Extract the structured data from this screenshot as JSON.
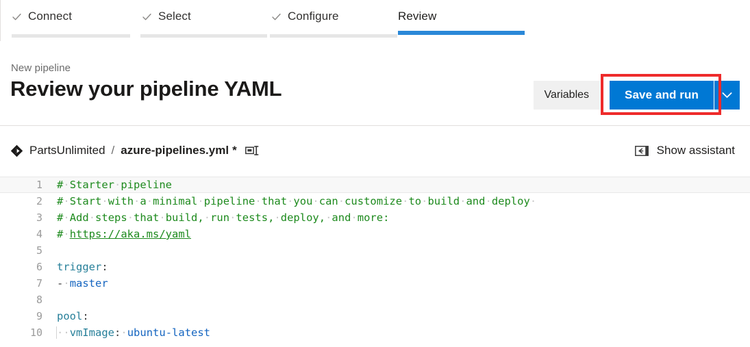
{
  "wizard": {
    "tabs": [
      {
        "label": "Connect",
        "state": "complete",
        "icon": "check-icon"
      },
      {
        "label": "Select",
        "state": "complete",
        "icon": "check-icon"
      },
      {
        "label": "Configure",
        "state": "complete",
        "icon": "check-icon"
      },
      {
        "label": "Review",
        "state": "active",
        "icon": ""
      }
    ],
    "active_accent": "#2b88d8",
    "complete_bar": "#e6e6e6"
  },
  "header": {
    "breadcrumb": "New pipeline",
    "title": "Review your pipeline YAML",
    "variables_label": "Variables",
    "save_label": "Save and run",
    "save_caret_icon": "chevron-down-icon",
    "primary_color": "#0078d4",
    "highlight_color": "#ee2b2b"
  },
  "file_bar": {
    "repo_icon": "azure-repos-icon",
    "repo_name": "PartsUnlimited",
    "separator": "/",
    "file_name": "azure-pipelines.yml",
    "dirty_marker": "*",
    "rename_icon": "rename-icon",
    "assistant_icon": "show-panel-icon",
    "assistant_label": "Show assistant"
  },
  "editor": {
    "language": "yaml",
    "current_line": 1,
    "lines": [
      {
        "n": "1",
        "segments": [
          {
            "t": "#",
            "c": "tok-comment"
          },
          {
            "t": "·",
            "c": "ws"
          },
          {
            "t": "Starter",
            "c": "tok-comment"
          },
          {
            "t": "·",
            "c": "ws"
          },
          {
            "t": "pipeline",
            "c": "tok-comment"
          }
        ]
      },
      {
        "n": "2",
        "segments": [
          {
            "t": "#",
            "c": "tok-comment"
          },
          {
            "t": "·",
            "c": "ws"
          },
          {
            "t": "Start",
            "c": "tok-comment"
          },
          {
            "t": "·",
            "c": "ws"
          },
          {
            "t": "with",
            "c": "tok-comment"
          },
          {
            "t": "·",
            "c": "ws"
          },
          {
            "t": "a",
            "c": "tok-comment"
          },
          {
            "t": "·",
            "c": "ws"
          },
          {
            "t": "minimal",
            "c": "tok-comment"
          },
          {
            "t": "·",
            "c": "ws"
          },
          {
            "t": "pipeline",
            "c": "tok-comment"
          },
          {
            "t": "·",
            "c": "ws"
          },
          {
            "t": "that",
            "c": "tok-comment"
          },
          {
            "t": "·",
            "c": "ws"
          },
          {
            "t": "you",
            "c": "tok-comment"
          },
          {
            "t": "·",
            "c": "ws"
          },
          {
            "t": "can",
            "c": "tok-comment"
          },
          {
            "t": "·",
            "c": "ws"
          },
          {
            "t": "customize",
            "c": "tok-comment"
          },
          {
            "t": "·",
            "c": "ws"
          },
          {
            "t": "to",
            "c": "tok-comment"
          },
          {
            "t": "·",
            "c": "ws"
          },
          {
            "t": "build",
            "c": "tok-comment"
          },
          {
            "t": "·",
            "c": "ws"
          },
          {
            "t": "and",
            "c": "tok-comment"
          },
          {
            "t": "·",
            "c": "ws"
          },
          {
            "t": "deploy",
            "c": "tok-comment"
          },
          {
            "t": "·",
            "c": "ws"
          }
        ]
      },
      {
        "n": "3",
        "segments": [
          {
            "t": "#",
            "c": "tok-comment"
          },
          {
            "t": "·",
            "c": "ws"
          },
          {
            "t": "Add",
            "c": "tok-comment"
          },
          {
            "t": "·",
            "c": "ws"
          },
          {
            "t": "steps",
            "c": "tok-comment"
          },
          {
            "t": "·",
            "c": "ws"
          },
          {
            "t": "that",
            "c": "tok-comment"
          },
          {
            "t": "·",
            "c": "ws"
          },
          {
            "t": "build,",
            "c": "tok-comment"
          },
          {
            "t": "·",
            "c": "ws"
          },
          {
            "t": "run",
            "c": "tok-comment"
          },
          {
            "t": "·",
            "c": "ws"
          },
          {
            "t": "tests,",
            "c": "tok-comment"
          },
          {
            "t": "·",
            "c": "ws"
          },
          {
            "t": "deploy,",
            "c": "tok-comment"
          },
          {
            "t": "·",
            "c": "ws"
          },
          {
            "t": "and",
            "c": "tok-comment"
          },
          {
            "t": "·",
            "c": "ws"
          },
          {
            "t": "more:",
            "c": "tok-comment"
          }
        ]
      },
      {
        "n": "4",
        "segments": [
          {
            "t": "#",
            "c": "tok-comment"
          },
          {
            "t": "·",
            "c": "ws"
          },
          {
            "t": "https://aka.ms/yaml",
            "c": "tok-link"
          }
        ]
      },
      {
        "n": "5",
        "segments": []
      },
      {
        "n": "6",
        "segments": [
          {
            "t": "trigger",
            "c": "tok-key"
          },
          {
            "t": ":",
            "c": "tok-punct"
          }
        ]
      },
      {
        "n": "7",
        "segments": [
          {
            "t": "-",
            "c": "tok-dash"
          },
          {
            "t": "·",
            "c": "ws"
          },
          {
            "t": "master",
            "c": "tok-value"
          }
        ]
      },
      {
        "n": "8",
        "segments": []
      },
      {
        "n": "9",
        "segments": [
          {
            "t": "pool",
            "c": "tok-key"
          },
          {
            "t": ":",
            "c": "tok-punct"
          }
        ]
      },
      {
        "n": "10",
        "segments": [
          {
            "t": "·",
            "c": "ws indent-guide"
          },
          {
            "t": "·",
            "c": "ws"
          },
          {
            "t": "vmImage",
            "c": "tok-key"
          },
          {
            "t": ":",
            "c": "tok-punct"
          },
          {
            "t": "·",
            "c": "ws"
          },
          {
            "t": "ubuntu-latest",
            "c": "tok-value"
          }
        ]
      }
    ]
  }
}
